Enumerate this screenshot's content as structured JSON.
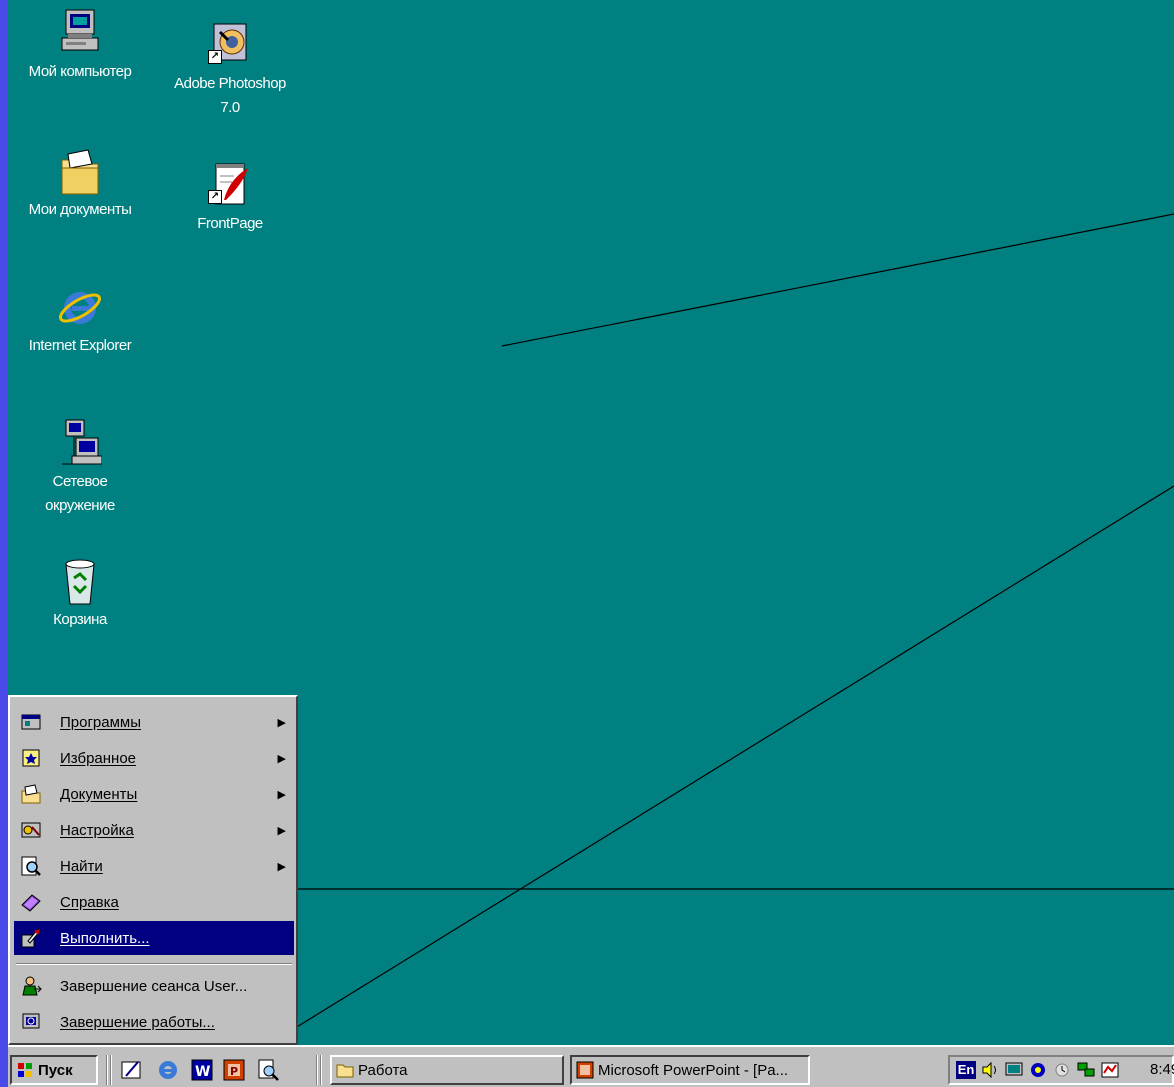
{
  "header_decoration": "",
  "desktop": {
    "icons": [
      {
        "label": "Мой компьютер",
        "icon": "my-computer-icon"
      },
      {
        "label": "Adobe Photoshop\n7.0",
        "icon": "photoshop-icon"
      },
      {
        "label": "Мои документы",
        "icon": "my-documents-icon"
      },
      {
        "label": "FrontPage",
        "icon": "frontpage-icon"
      },
      {
        "label": "Internet Explorer",
        "icon": "internet-explorer-icon"
      },
      {
        "label": "Сетевое\nокружение",
        "icon": "network-icon"
      },
      {
        "label": "Корзина",
        "icon": "recycle-bin-icon"
      }
    ]
  },
  "start_menu": {
    "items": [
      {
        "label": "Программы",
        "icon": "programs-icon",
        "submenu": true
      },
      {
        "label": "Избранное",
        "icon": "favorites-icon",
        "submenu": true
      },
      {
        "label": "Документы",
        "icon": "documents-icon",
        "submenu": true
      },
      {
        "label": "Настройка",
        "icon": "settings-icon",
        "submenu": true
      },
      {
        "label": "Найти",
        "icon": "find-icon",
        "submenu": true
      },
      {
        "label": "Справка",
        "icon": "help-icon",
        "submenu": false
      },
      {
        "label": "Выполнить...",
        "icon": "run-icon",
        "submenu": false,
        "selected": true
      },
      {
        "label": "Завершение сеанса User...",
        "icon": "logoff-icon",
        "submenu": false
      },
      {
        "label": "Завершение работы...",
        "icon": "shutdown-icon",
        "submenu": false
      }
    ],
    "arrow": "▶"
  },
  "taskbar": {
    "start_label": "Пуск",
    "quick_launch": [
      "show-desktop-icon",
      "internet-explorer-icon",
      "word-icon",
      "powerpoint-icon",
      "find-icon"
    ],
    "tasks": [
      {
        "label": "Работа",
        "icon": "folder-icon"
      },
      {
        "label": "Microsoft PowerPoint - [Pa...",
        "icon": "powerpoint-icon",
        "pressed": true
      }
    ],
    "tray": {
      "lang": "En",
      "clock": "8:49"
    }
  },
  "colors": {
    "desktop": "#008080",
    "menu_highlight": "#000080",
    "face": "#c0c0c0"
  }
}
